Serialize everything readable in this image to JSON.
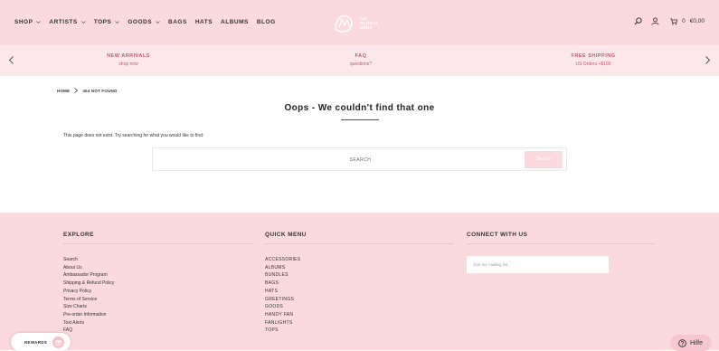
{
  "header": {
    "nav": [
      {
        "label": "SHOP",
        "has_dropdown": true
      },
      {
        "label": "ARTISTS",
        "has_dropdown": true
      },
      {
        "label": "TOPS",
        "has_dropdown": true
      },
      {
        "label": "GOODS",
        "has_dropdown": true
      },
      {
        "label": "BAGS",
        "has_dropdown": false
      },
      {
        "label": "HATS",
        "has_dropdown": false
      },
      {
        "label": "ALBUMS",
        "has_dropdown": false
      },
      {
        "label": "BLOG",
        "has_dropdown": false
      }
    ],
    "logo_text": [
      "SM",
      "GLOBAL",
      "SHOP"
    ],
    "cart_count": "0",
    "cart_total": "€0,00"
  },
  "promo": {
    "items": [
      {
        "title": "NEW ARRIVALS",
        "subtitle": "shop now"
      },
      {
        "title": "FAQ",
        "subtitle": "questions?"
      },
      {
        "title": "FREE SHIPPING",
        "subtitle": "US Orders +$100"
      }
    ]
  },
  "breadcrumb": {
    "home": "HOME",
    "current": "404 NOT FOUND"
  },
  "main": {
    "title": "Oops - We couldn't find that one",
    "message": "This page does not exist. Try searching for what you would like to find:",
    "search_placeholder": "SEARCH",
    "search_button": "Search"
  },
  "footer": {
    "explore": {
      "heading": "EXPLORE",
      "links": [
        "Search",
        "About Us",
        "Ambassador Program",
        "Shipping & Refund Policy",
        "Privacy Policy",
        "Terms of Service",
        "Size Charts",
        "Pre-order Information",
        "Text Alerts",
        "FAQ"
      ]
    },
    "quick_menu": {
      "heading": "QUICK MENU",
      "links": [
        "ACCESSORIES",
        "ALBUMS",
        "BUNDLES",
        "BAGS",
        "HATS",
        "GREETINGS",
        "GOODS",
        "HANDY FAN",
        "FANLIGHTS",
        "TOPS"
      ]
    },
    "connect": {
      "heading": "CONNECT WITH US",
      "mailing_placeholder": "Join our mailing list"
    }
  },
  "rewards": {
    "label": "REWARDS"
  },
  "help": {
    "label": "Hilfe"
  },
  "colors": {
    "header_bg": "#fadadd",
    "promo_bg": "#fce8ea",
    "accent": "#c65a6f"
  }
}
